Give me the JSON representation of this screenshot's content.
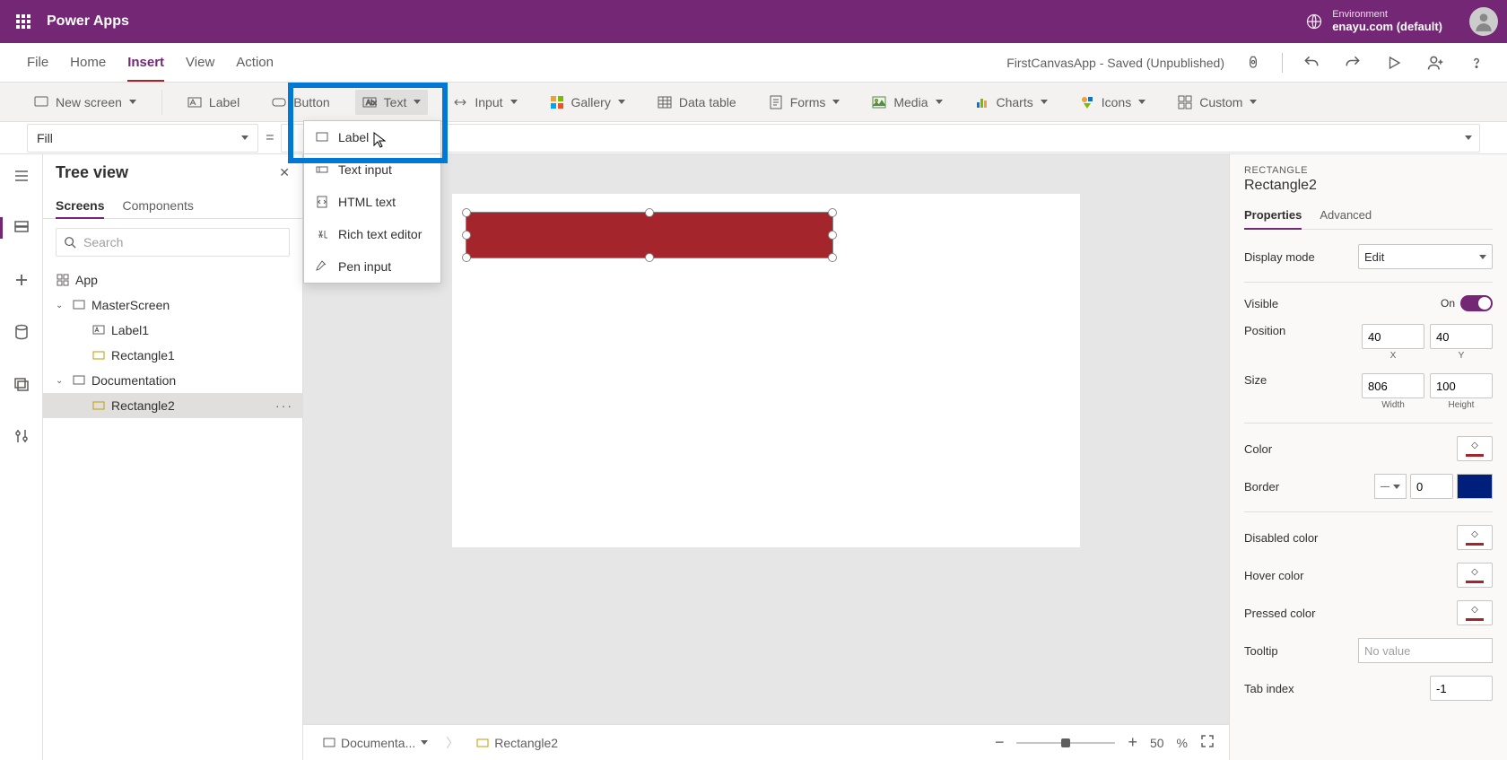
{
  "top": {
    "app_title": "Power Apps",
    "env_label": "Environment",
    "env_name": "enayu.com (default)"
  },
  "menu": {
    "items": [
      "File",
      "Home",
      "Insert",
      "View",
      "Action"
    ],
    "active": "Insert",
    "status": "FirstCanvasApp - Saved (Unpublished)"
  },
  "ribbon": {
    "new_screen": "New screen",
    "label": "Label",
    "button": "Button",
    "text": "Text",
    "input": "Input",
    "gallery": "Gallery",
    "data_table": "Data table",
    "forms": "Forms",
    "media": "Media",
    "charts": "Charts",
    "icons": "Icons",
    "custom": "Custom"
  },
  "formula": {
    "property": "Fill"
  },
  "tree": {
    "title": "Tree view",
    "tabs": [
      "Screens",
      "Components"
    ],
    "active_tab": "Screens",
    "search_placeholder": "Search",
    "items": {
      "app": "App",
      "master": "MasterScreen",
      "label1": "Label1",
      "rect1": "Rectangle1",
      "doc": "Documentation",
      "rect2": "Rectangle2"
    }
  },
  "text_menu": {
    "label": "Label",
    "text_input": "Text input",
    "html_text": "HTML text",
    "rich_text": "Rich text editor",
    "pen_input": "Pen input"
  },
  "props": {
    "type": "RECTANGLE",
    "name": "Rectangle2",
    "tabs": [
      "Properties",
      "Advanced"
    ],
    "display_mode_label": "Display mode",
    "display_mode_value": "Edit",
    "visible_label": "Visible",
    "visible_text": "On",
    "position_label": "Position",
    "pos_x": "40",
    "pos_y": "40",
    "pos_x_l": "X",
    "pos_y_l": "Y",
    "size_label": "Size",
    "size_w": "806",
    "size_h": "100",
    "size_w_l": "Width",
    "size_h_l": "Height",
    "color_label": "Color",
    "border_label": "Border",
    "border_width": "0",
    "disabled_color": "Disabled color",
    "hover_color": "Hover color",
    "pressed_color": "Pressed color",
    "tooltip_label": "Tooltip",
    "tooltip_placeholder": "No value",
    "tab_index_label": "Tab index",
    "tab_index_value": "-1"
  },
  "crumb": {
    "screen": "Documenta...",
    "item": "Rectangle2",
    "zoom_value": "50",
    "zoom_pct": "%"
  },
  "colors": {
    "rect_fill": "#a4262c",
    "border_color": "#001f7a"
  }
}
